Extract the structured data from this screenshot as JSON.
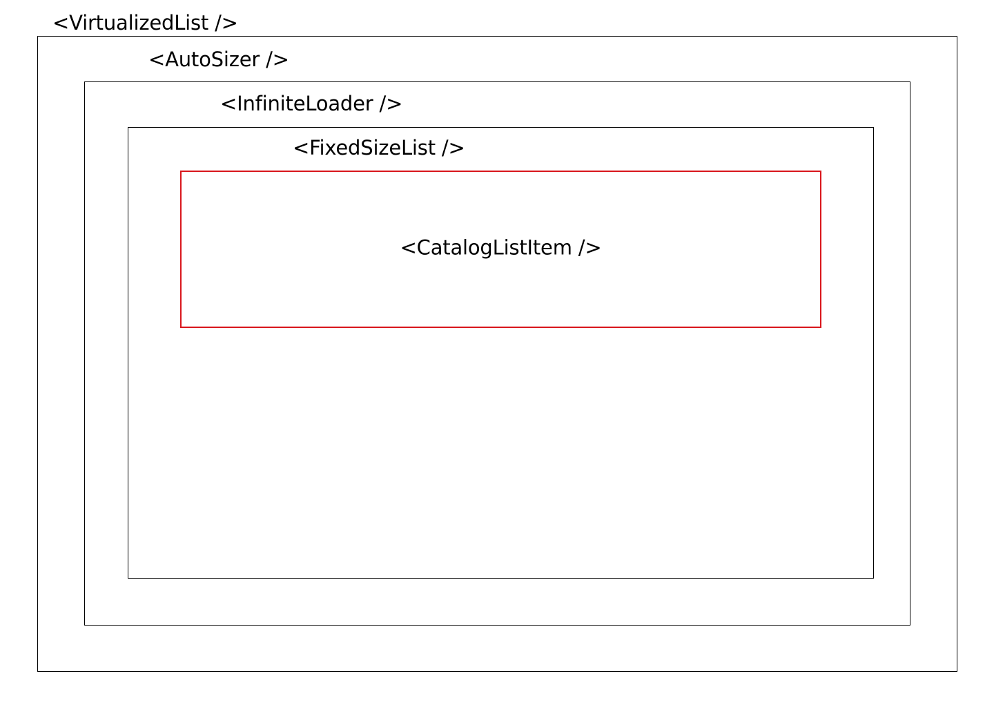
{
  "diagram": {
    "virtualized_list": {
      "label": "<VirtualizedList />"
    },
    "auto_sizer": {
      "label": "<AutoSizer />"
    },
    "infinite_loader": {
      "label": "<InfiniteLoader />"
    },
    "fixed_size_list": {
      "label": "<FixedSizeList />"
    },
    "catalog_list_item": {
      "label": "<CatalogListItem />"
    }
  },
  "colors": {
    "border": "#000000",
    "highlight": "#d9161c",
    "background": "#ffffff"
  }
}
